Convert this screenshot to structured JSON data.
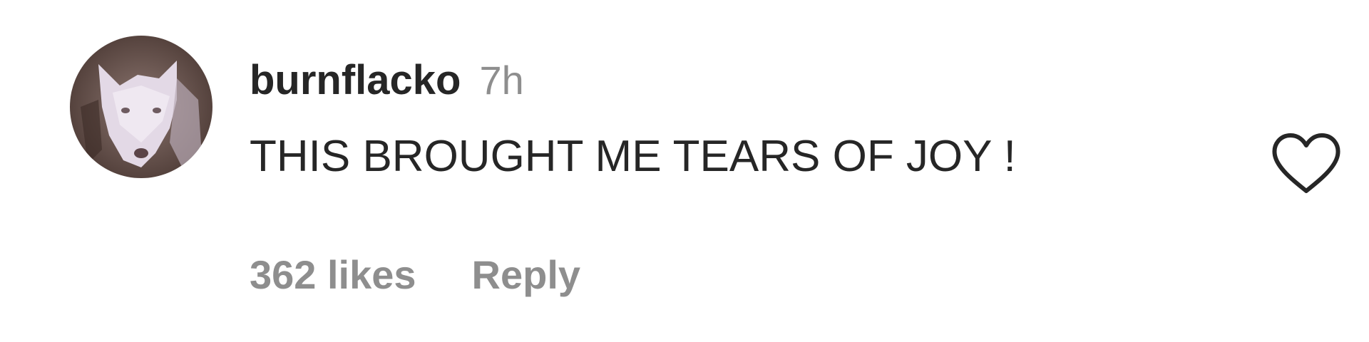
{
  "comment": {
    "avatar": {
      "icon": "profile-photo-white-dog",
      "colors": {
        "background": "#5b4741",
        "subject": "#e6dde8"
      }
    },
    "username": "burnflacko",
    "timestamp": "7h",
    "text": "THIS BROUGHT ME TEARS OF JOY !",
    "like_icon": "heart-outline-icon",
    "likes_label": "362 likes",
    "reply_label": "Reply"
  },
  "colors": {
    "primary_text": "#262626",
    "secondary_text": "#8e8e8e",
    "background": "#ffffff"
  }
}
